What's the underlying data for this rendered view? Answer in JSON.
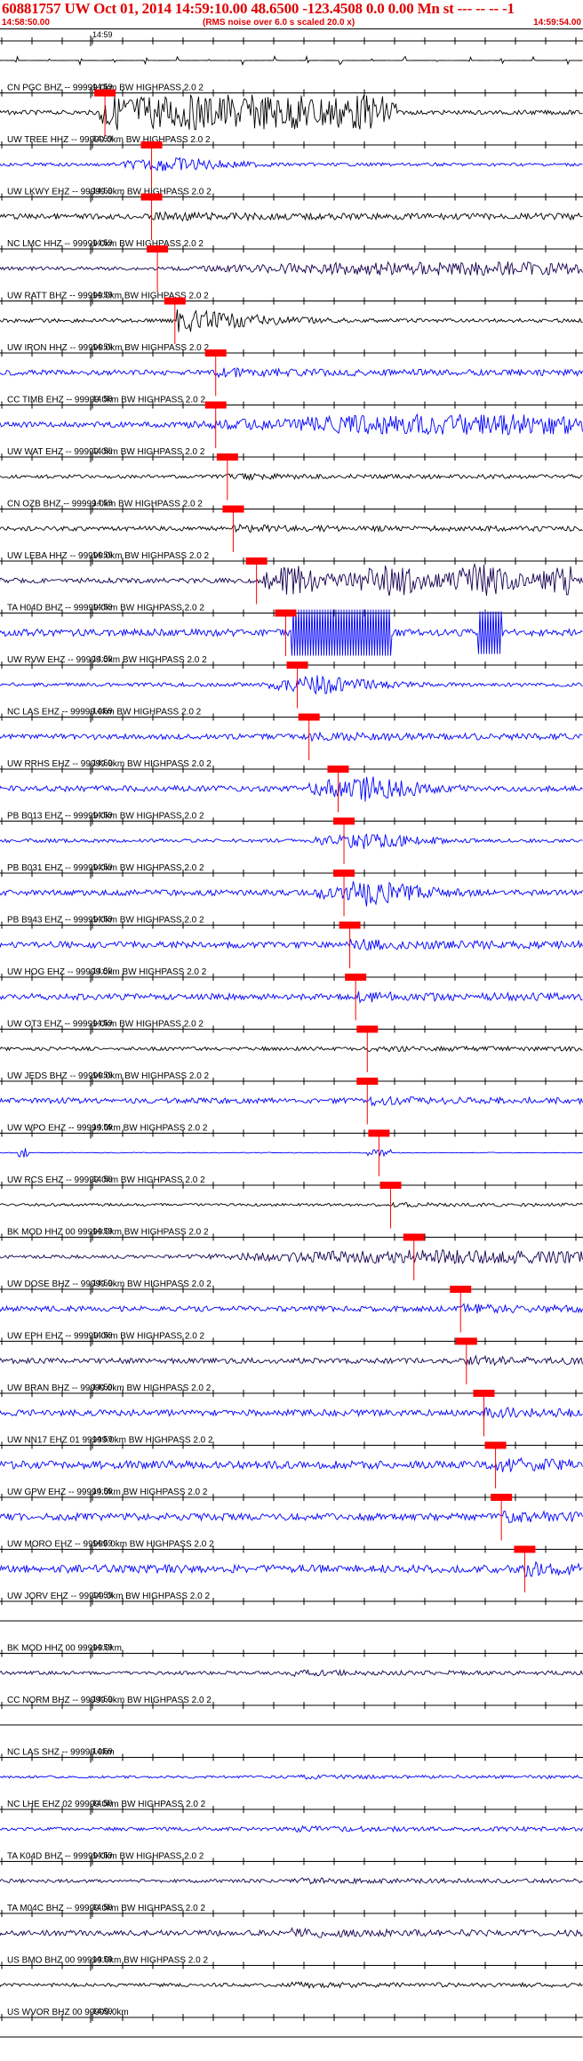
{
  "header": {
    "title": "60881757 UW Oct 01, 2014 14:59:10.00   48.6500  -123.4508   0.0 0.00 Mn st --- -- -- -1",
    "time_left": "14:58:50.00",
    "subtitle": "(RMS noise over 6.0 s scaled 20.0 x)",
    "time_right": "14:59:54.00"
  },
  "colors": {
    "blue": "#0000ff",
    "purple": "#140050",
    "black": "#000000",
    "pick": "#ff0000"
  },
  "minute_label": "14:59",
  "traces": [
    {
      "label": "",
      "color": "black",
      "amp": 0.25,
      "env": "pulses",
      "pick": null
    },
    {
      "label": "CN PGC BHZ -- 99999.0km BW  HIGHPASS  2.0  2",
      "color": "black",
      "amp": 1.0,
      "env": "block",
      "pick": 0.18
    },
    {
      "label": "UW TREE HHZ -- 99999.0km BW  HIGHPASS  2.0  2",
      "color": "blue",
      "amp": 0.45,
      "env": "mid",
      "pick": 0.26
    },
    {
      "label": "UW LKWY EHZ -- 99999.0km BW  HIGHPASS  2.0  2",
      "color": "black",
      "amp": 0.3,
      "env": "low",
      "pick": 0.26
    },
    {
      "label": "NC LMC HHZ -- 99999.0km BW  HIGHPASS  2.0  2",
      "color": "purple",
      "amp": 0.4,
      "env": "late",
      "pick": 0.27
    },
    {
      "label": "UW RATT BHZ -- 99999.0km BW  HIGHPASS  2.0  2",
      "color": "black",
      "amp": 0.75,
      "env": "early",
      "pick": 0.3
    },
    {
      "label": "UW IRON HHZ -- 99999.0km BW  HIGHPASS  2.0  2",
      "color": "blue",
      "amp": 0.3,
      "env": "low",
      "pick": 0.37
    },
    {
      "label": "CC TIMB EHZ -- 99999.0km BW  HIGHPASS  2.0  2",
      "color": "blue",
      "amp": 0.6,
      "env": "late",
      "pick": 0.37
    },
    {
      "label": "UW WAT EHZ -- 99999.0km BW  HIGHPASS  2.0  2",
      "color": "black",
      "amp": 0.2,
      "env": "low",
      "pick": 0.39
    },
    {
      "label": "CN OZB BHZ -- 99999.0km BW  HIGHPASS  2.0  2",
      "color": "black",
      "amp": 0.25,
      "env": "low",
      "pick": 0.4
    },
    {
      "label": "UW LEBA HHZ -- 99999.0km BW  HIGHPASS  2.0  2",
      "color": "purple",
      "amp": 0.95,
      "env": "block2",
      "pick": 0.44
    },
    {
      "label": "TA H04D BHZ -- 99999.0km BW  HIGHPASS  2.0  2",
      "color": "blue",
      "amp": 1.0,
      "env": "clip",
      "pick": 0.49
    },
    {
      "label": "UW RVW EHZ -- 99999.0km BW  HIGHPASS  2.0  2",
      "color": "blue",
      "amp": 0.55,
      "env": "mid",
      "pick": 0.51
    },
    {
      "label": "NC LAS EHZ -- 99999.0km BW  HIGHPASS  2.0  2",
      "color": "blue",
      "amp": 0.3,
      "env": "low",
      "pick": 0.53
    },
    {
      "label": "UW RRHS EHZ -- 99999.0km BW  HIGHPASS  2.0  2",
      "color": "blue",
      "amp": 0.8,
      "env": "mid",
      "pick": 0.58
    },
    {
      "label": "PB B013 EHZ -- 99999.0km BW  HIGHPASS  2.0  2",
      "color": "blue",
      "amp": 0.5,
      "env": "mid",
      "pick": 0.59
    },
    {
      "label": "PB B031 EHZ -- 99999.0km BW  HIGHPASS  2.0  2",
      "color": "blue",
      "amp": 0.8,
      "env": "mid",
      "pick": 0.59
    },
    {
      "label": "PB B943 EHZ -- 99999.0km BW  HIGHPASS  2.0  2",
      "color": "blue",
      "amp": 0.35,
      "env": "low",
      "pick": 0.6
    },
    {
      "label": "UW HOG EHZ -- 99999.0km BW  HIGHPASS  2.0  2",
      "color": "blue",
      "amp": 0.35,
      "env": "low",
      "pick": 0.61
    },
    {
      "label": "UW OT3 EHZ -- 99999.0km BW  HIGHPASS  2.0  2",
      "color": "black",
      "amp": 0.2,
      "env": "low",
      "pick": 0.63
    },
    {
      "label": "UW JEDS BHZ -- 99999.0km BW  HIGHPASS  2.0  2",
      "color": "blue",
      "amp": 0.3,
      "env": "low",
      "pick": 0.63
    },
    {
      "label": "UW WPO EHZ -- 99999.0km BW  HIGHPASS  2.0  2",
      "color": "blue",
      "amp": 0.2,
      "env": "spike",
      "pick": 0.65
    },
    {
      "label": "UW RCS EHZ -- 99999.0km BW  HIGHPASS  2.0  2",
      "color": "black",
      "amp": 0.15,
      "env": "low",
      "pick": 0.67
    },
    {
      "label": "BK MOD HHZ 00 99999.0km BW  HIGHPASS  2.0  2",
      "color": "purple",
      "amp": 0.4,
      "env": "late",
      "pick": 0.71
    },
    {
      "label": "UW DOSE BHZ -- 99999.0km BW  HIGHPASS  2.0  2",
      "color": "blue",
      "amp": 0.3,
      "env": "low",
      "pick": 0.79
    },
    {
      "label": "UW EPH EHZ -- 99999.0km BW  HIGHPASS  2.0  2",
      "color": "purple",
      "amp": 0.3,
      "env": "low",
      "pick": 0.8
    },
    {
      "label": "UW BRAN BHZ -- 99999.0km BW  HIGHPASS  2.0  2",
      "color": "blue",
      "amp": 0.35,
      "env": "low",
      "pick": 0.83
    },
    {
      "label": "UW NN17 EHZ 01 99999.0km BW  HIGHPASS  2.0  2",
      "color": "blue",
      "amp": 0.45,
      "env": "low",
      "pick": 0.85
    },
    {
      "label": "UW GPW EHZ -- 99999.0km BW  HIGHPASS  2.0  2",
      "color": "blue",
      "amp": 0.4,
      "env": "low",
      "pick": 0.86
    },
    {
      "label": "UW MORO EHZ -- 99999.0km BW  HIGHPASS  2.0  2",
      "color": "blue",
      "amp": 0.45,
      "env": "low",
      "pick": 0.9
    },
    {
      "label": "UW JORV EHZ -- 99999.0km BW  HIGHPASS  2.0  2",
      "color": "black",
      "amp": 0.0,
      "env": "flat",
      "pick": null
    },
    {
      "label": "BK MOD HHZ 00 99999.0km",
      "color": "purple",
      "amp": 0.2,
      "env": "low",
      "pick": null
    },
    {
      "label": "CC NORM BHZ -- 99999.0km BW  HIGHPASS  2.0  2",
      "color": "black",
      "amp": 0.0,
      "env": "flat",
      "pick": null
    },
    {
      "label": "NC LAS SHZ -- 99999.0km",
      "color": "blue",
      "amp": 0.15,
      "env": "low",
      "pick": null
    },
    {
      "label": "NC LHE EHZ 02 99999.0km BW  HIGHPASS  2.0  2",
      "color": "blue",
      "amp": 0.2,
      "env": "low",
      "pick": null
    },
    {
      "label": "TA K04D BHZ -- 99999.0km BW  HIGHPASS  2.0  2",
      "color": "purple",
      "amp": 0.2,
      "env": "low",
      "pick": null
    },
    {
      "label": "TA M04C BHZ -- 99999.0km BW  HIGHPASS  2.0  2",
      "color": "purple",
      "amp": 0.3,
      "env": "low",
      "pick": null
    },
    {
      "label": "US BMO BHZ 00 99999.0km BW  HIGHPASS  2.0  2",
      "color": "black",
      "amp": 0.2,
      "env": "low",
      "pick": null
    },
    {
      "label": "US WVOR BHZ 00 99999.0km",
      "color": "black",
      "amp": 0.0,
      "env": "flat",
      "pick": null
    }
  ]
}
